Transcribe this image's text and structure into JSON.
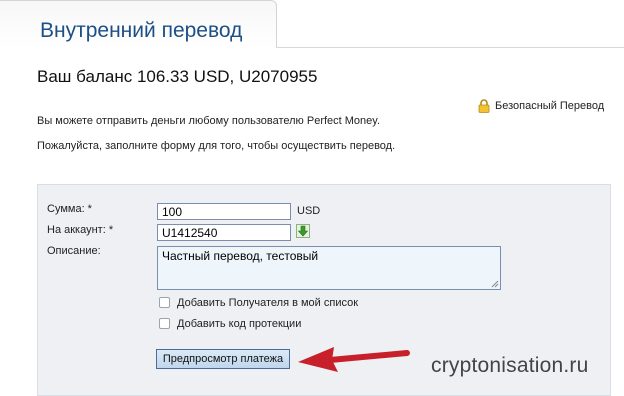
{
  "tab": {
    "title": "Внутренний перевод"
  },
  "balance_text": "Ваш баланс 106.33 USD, U2070955",
  "secure_transfer_label": "Безопасный Перевод",
  "info": {
    "line1": "Вы можете отправить деньги любому пользователю Perfect Money.",
    "line2": "Пожалуйста, заполните форму для того, чтобы осуществить перевод."
  },
  "form": {
    "amount_label": "Сумма: *",
    "amount_value": "100",
    "amount_unit": "USD",
    "account_label": "На аккаунт: *",
    "account_value": "U1412540",
    "description_label": "Описание:",
    "description_value": "Частный перевод, тестовый",
    "add_recipient_label": "Добавить Получателя в мой список",
    "add_protection_label": "Добавить код протекции",
    "preview_button": "Предпросмотр платежа"
  },
  "watermark": "cryptonisation.ru",
  "colors": {
    "title_blue": "#1d4f86",
    "panel_bg": "#eef0f4",
    "arrow_red": "#c8202a"
  }
}
